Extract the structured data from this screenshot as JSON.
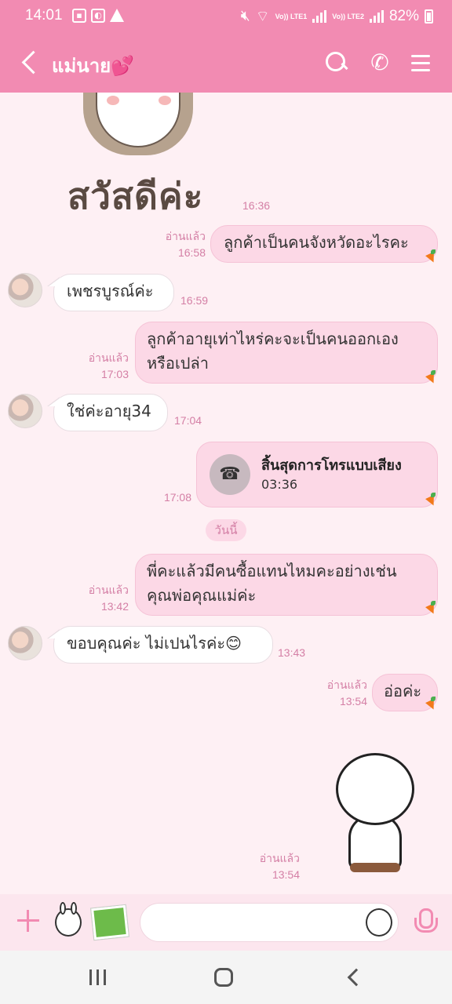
{
  "status_bar": {
    "time": "14:01",
    "signal1_label": "Vo)) LTE1",
    "signal2_label": "Vo)) LTE2",
    "battery": "82%"
  },
  "header": {
    "title": "แม่นาย💕"
  },
  "messages": {
    "sticker_greeting": {
      "text": "สวัสดีค่ะ",
      "time": "16:36"
    },
    "m1": {
      "text": "ลูกค้าเป็นคนจังหวัดอะไรคะ",
      "read": "อ่านแล้ว",
      "time": "16:58"
    },
    "m2": {
      "text": "เพชรบูรณ์ค่ะ",
      "time": "16:59"
    },
    "m3": {
      "line1": "ลูกค้าอายุเท่าไหร่คะจะเป็นคนออกเอง",
      "line2": "หรือเปล่า",
      "read": "อ่านแล้ว",
      "time": "17:03"
    },
    "m4": {
      "text": "ใช่ค่ะอายุ34",
      "time": "17:04"
    },
    "call": {
      "title": "สิ้นสุดการโทรแบบเสียง",
      "duration": "03:36",
      "time": "17:08"
    },
    "day_separator": "วันนี้",
    "m5": {
      "line1": "พี่คะแล้วมีคนซื้อแทนไหมคะอย่างเช่น",
      "line2": "คุณพ่อคุณแม่ค่ะ",
      "read": "อ่านแล้ว",
      "time": "13:42"
    },
    "m6": {
      "text": "ขอบคุณค่ะ ไม่เปนไรค่ะ😊",
      "time": "13:43"
    },
    "m7": {
      "text": "อ่อค่ะ",
      "read": "อ่านแล้ว",
      "time": "13:54"
    },
    "sticker_bear": {
      "read": "อ่านแล้ว",
      "time": "13:54"
    }
  },
  "input_bar": {
    "placeholder": ""
  },
  "colors": {
    "header": "#f28bb2",
    "chat_bg": "#fef0f4",
    "outgoing_bubble": "#fcd8e6",
    "meta_text": "#d47fa5"
  }
}
